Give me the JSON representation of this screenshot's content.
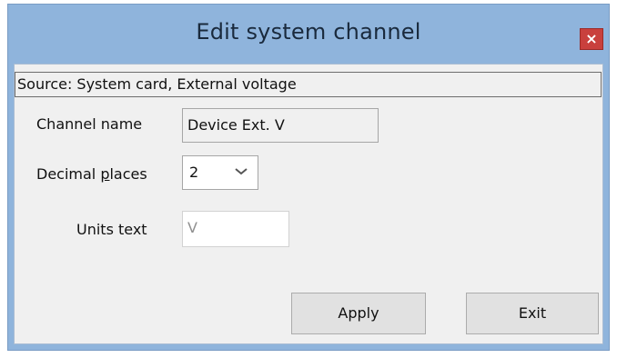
{
  "window": {
    "title": "Edit system channel",
    "close_label": "×"
  },
  "source": {
    "text": "Source: System card, External voltage"
  },
  "channel_name": {
    "label": "Channel name",
    "value": "Device Ext. V"
  },
  "decimal_places": {
    "label_pre": "Decimal ",
    "label_mnemonic": "p",
    "label_post": "laces",
    "selected": "2"
  },
  "units": {
    "label": "Units text",
    "value": "V"
  },
  "buttons": {
    "apply": "Apply",
    "exit": "Exit"
  },
  "icons": {
    "close": "close-icon",
    "dropdown": "chevron-down-icon"
  },
  "colors": {
    "frame": "#8fb4dc",
    "close_button": "#c9403d",
    "client": "#f0f0f0"
  }
}
